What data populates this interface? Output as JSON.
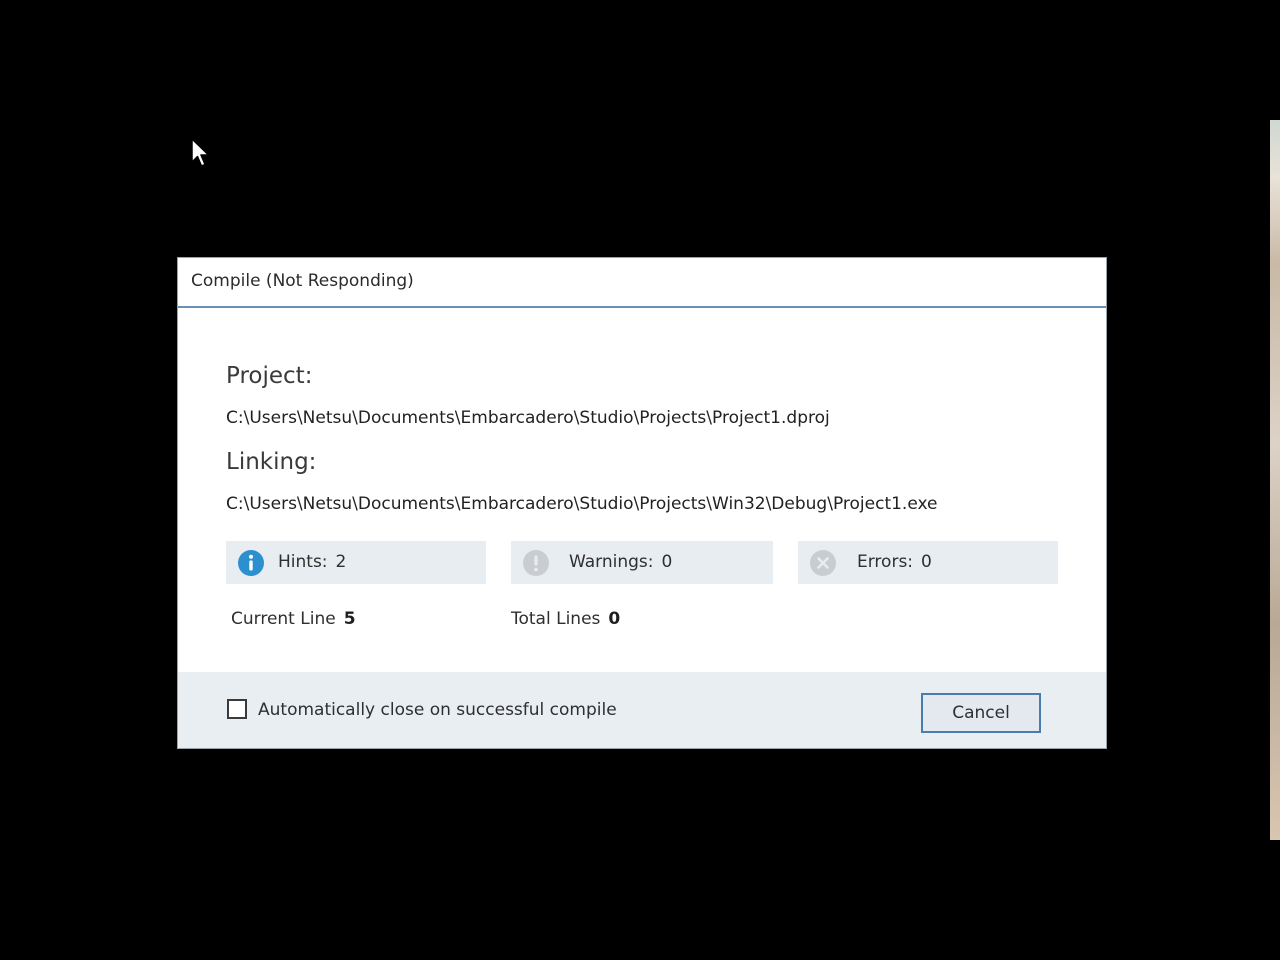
{
  "dialog": {
    "title": "Compile (Not Responding)",
    "project_label": "Project:",
    "project_path": "C:\\Users\\Netsu\\Documents\\Embarcadero\\Studio\\Projects\\Project1.dproj",
    "linking_label": "Linking:",
    "linking_path": "C:\\Users\\Netsu\\Documents\\Embarcadero\\Studio\\Projects\\Win32\\Debug\\Project1.exe"
  },
  "stats": {
    "hints": {
      "label": "Hints:",
      "value": "2",
      "icon": "info-icon",
      "color": "#2b8fd0"
    },
    "warnings": {
      "label": "Warnings:",
      "value": "0",
      "icon": "warning-icon",
      "color": "#c9cdd1"
    },
    "errors": {
      "label": "Errors:",
      "value": "0",
      "icon": "error-icon",
      "color": "#c9cdd1"
    }
  },
  "lines": {
    "current_label": "Current Line",
    "current_value": "5",
    "total_label": "Total Lines",
    "total_value": "0"
  },
  "footer": {
    "auto_close_label": "Automatically close on successful compile",
    "auto_close_checked": false,
    "cancel_label": "Cancel"
  },
  "colors": {
    "background": "#000000",
    "dialog": "#ffffff",
    "footer": "#e9eef3",
    "accent_border": "#4b7cae"
  }
}
